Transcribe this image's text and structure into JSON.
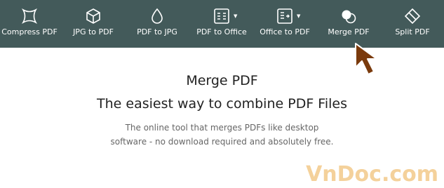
{
  "toolbar": {
    "items": [
      {
        "label": "Compress PDF",
        "icon": "compress-icon"
      },
      {
        "label": "JPG to PDF",
        "icon": "jpg-to-pdf-icon"
      },
      {
        "label": "PDF to JPG",
        "icon": "pdf-to-jpg-icon"
      },
      {
        "label": "PDF to Office",
        "icon": "pdf-to-office-icon",
        "has_dropdown": true
      },
      {
        "label": "Office to PDF",
        "icon": "office-to-pdf-icon",
        "has_dropdown": true
      },
      {
        "label": "Merge PDF",
        "icon": "merge-icon"
      },
      {
        "label": "Split PDF",
        "icon": "split-icon"
      }
    ],
    "background_color": "#435a5a",
    "text_color": "#ffffff"
  },
  "hero": {
    "title": "Merge PDF",
    "subtitle": "The easiest way to combine PDF Files",
    "description_line1": "The online tool that merges PDFs like desktop",
    "description_line2": "software - no download required and absolutely free."
  },
  "cursor": {
    "icon": "arrow-cursor-icon",
    "color": "#7a3a0c"
  },
  "watermark": {
    "text": "VnDoc.com",
    "color": "#f2c98a"
  }
}
